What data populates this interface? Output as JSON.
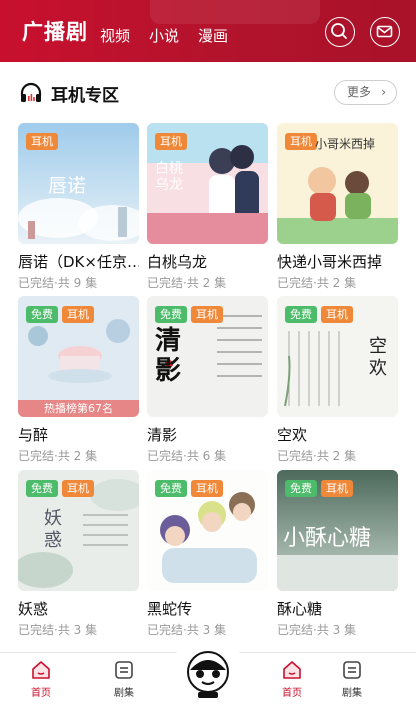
{
  "header": {
    "brand": "广播剧",
    "tabs": [
      {
        "label": "视频"
      },
      {
        "label": "小说"
      },
      {
        "label": "漫画"
      }
    ],
    "icons": {
      "search": "search-icon",
      "message": "mail-icon"
    }
  },
  "section": {
    "icon": "headphones-icon",
    "title": "耳机专区",
    "more_label": "更多"
  },
  "cards": [
    {
      "title": "唇诺（DK×任京…",
      "meta": "已完结·共 9 集",
      "badges": [
        "耳机"
      ],
      "cover_text": "唇诺"
    },
    {
      "title": "白桃乌龙",
      "meta": "已完结·共 2 集",
      "badges": [
        "耳机"
      ],
      "cover_text": "白桃乌龙"
    },
    {
      "title": "快递小哥米西掉",
      "meta": "已完结·共 2 集",
      "badges": [
        "耳机"
      ],
      "cover_text": "小哥米西掉"
    },
    {
      "title": "与醉",
      "meta": "已完结·共 2 集",
      "badges": [
        "免费",
        "耳机"
      ],
      "cover_text": "",
      "ribbon": "热播榜第67名"
    },
    {
      "title": "清影",
      "meta": "已完结·共 6 集",
      "badges": [
        "免费",
        "耳机"
      ],
      "cover_text": "清影"
    },
    {
      "title": "空欢",
      "meta": "已完结·共 2 集",
      "badges": [
        "免费",
        "耳机"
      ],
      "cover_text": "空欢"
    },
    {
      "title": "妖惑",
      "meta": "已完结·共 3 集",
      "badges": [
        "免费",
        "耳机"
      ],
      "cover_text": "妖惑"
    },
    {
      "title": "黑蛇传",
      "meta": "已完结·共 3 集",
      "badges": [
        "免费",
        "耳机"
      ],
      "cover_text": ""
    },
    {
      "title": "酥心糖",
      "meta": "已完结·共 3 集",
      "badges": [
        "免费",
        "耳机"
      ],
      "cover_text": "小酥心糖"
    }
  ],
  "bottom_nav": [
    {
      "label": "首页",
      "icon": "home-icon",
      "active": true
    },
    {
      "label": "剧集",
      "icon": "list-icon",
      "active": false
    },
    {
      "label": "",
      "icon": "mascot-icon",
      "active": false
    },
    {
      "label": "首页",
      "icon": "home-icon",
      "active": true
    },
    {
      "label": "剧集",
      "icon": "list-icon",
      "active": false
    }
  ],
  "colors": {
    "accent": "#c8102e",
    "badge_free": "#4cbb6a",
    "badge_earphone": "#f0883a"
  }
}
